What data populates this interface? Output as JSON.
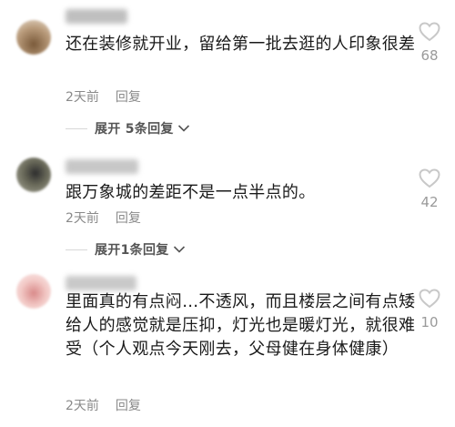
{
  "comments": [
    {
      "text": "还在装修就开业，留给第一批去逛的人印象很差",
      "time": "2天前",
      "reply_label": "回复",
      "likes": "68",
      "expand_label": "展开 5条回复"
    },
    {
      "text": "跟万象城的差距不是一点半点的。",
      "time": "2天前",
      "reply_label": "回复",
      "likes": "42",
      "expand_label": "展开1条回复"
    },
    {
      "text": "里面真的有点闷…不透风，而且楼层之间有点矮给人的感觉就是压抑，灯光也是暖灯光，就很难受（个人观点今天刚去，父母健在身体健康）",
      "time": "2天前",
      "reply_label": "回复",
      "likes": "10"
    }
  ],
  "icons": {
    "like": "heart-outline-icon",
    "expand": "chevron-down-icon"
  },
  "colors": {
    "text": "#1a1a1a",
    "meta": "#8a8a8a",
    "icon": "#c8c8c8"
  }
}
